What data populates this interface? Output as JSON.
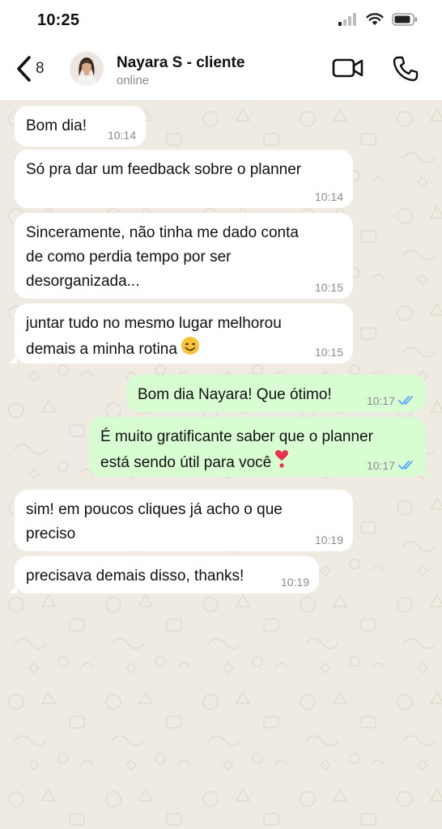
{
  "status_bar": {
    "time": "10:25"
  },
  "header": {
    "back_count": "8",
    "contact_name": "Nayara S - cliente",
    "contact_status": "online"
  },
  "messages": [
    {
      "dir": "in",
      "text": "Bom dia!",
      "time": "10:14"
    },
    {
      "dir": "in",
      "text": "Só pra dar um feedback sobre o planner",
      "time": "10:14"
    },
    {
      "dir": "in",
      "lines": [
        "Sinceramente, não tinha me dado conta",
        "de como perdia tempo por ser",
        "desorganizada..."
      ],
      "time": "10:15"
    },
    {
      "dir": "in",
      "lines": [
        "juntar tudo no mesmo lugar melhorou",
        "demais a minha rotina"
      ],
      "emoji": "smiling-face-emoji",
      "time": "10:15"
    },
    {
      "dir": "out",
      "text": "Bom dia Nayara! Que ótimo!",
      "time": "10:17",
      "read": true
    },
    {
      "dir": "out",
      "lines": [
        "É muito gratificante saber que o planner",
        "está sendo útil para você"
      ],
      "emoji": "heart-exclamation-emoji",
      "time": "10:17",
      "read": true
    },
    {
      "dir": "in",
      "lines": [
        "sim! em poucos cliques já acho o que",
        "preciso"
      ],
      "time": "10:19"
    },
    {
      "dir": "in",
      "text": "precisava demais disso, thanks!",
      "time": "10:19"
    }
  ],
  "colors": {
    "chat_background": "#efeae2",
    "incoming_bubble": "#ffffff",
    "outgoing_bubble": "#d9fdd3",
    "read_ticks": "#53a6fa"
  }
}
